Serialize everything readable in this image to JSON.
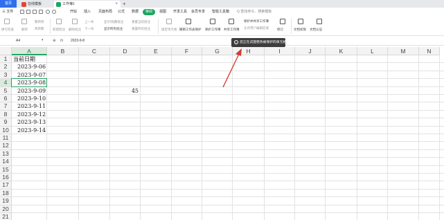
{
  "tabs": {
    "home": "首页",
    "items": [
      {
        "label": "在线模板",
        "icon_color": "#e0463b"
      },
      {
        "label": "工作簿1",
        "icon_color": "#1fa463"
      }
    ],
    "close": "×",
    "add": "+"
  },
  "menu": {
    "file": "三 文件",
    "items": [
      "开始",
      "插入",
      "页面布局",
      "公式",
      "数据",
      "审阅",
      "视图",
      "开发工具",
      "会员专享",
      "智能工具箱"
    ],
    "active": "审阅",
    "search_placeholder": "Q 查找命令、搜索模板"
  },
  "ribbon": {
    "row1": [
      "拼写检查",
      "翻译",
      "校对",
      "新建批注",
      "删除批注",
      "上一条",
      "下一条",
      "显示/隐藏批注",
      "显示所有批注",
      "重置当前批注",
      "重置所有批注",
      "锁定单元格",
      "保护工作表",
      "保护工作簿",
      "共享工作簿",
      "保护并共享工作簿",
      "允许用户编辑区域",
      "修订",
      "文档权限",
      "文档认证"
    ],
    "labels": {
      "spell": "拼写检查·",
      "research": "翻译",
      "proof": "校对",
      "word_count": "繁转简",
      "simp_trad": "简转繁",
      "new_comment": "新建批注",
      "del_comment": "删除批注",
      "prev": "上一条",
      "next": "下一条",
      "show_hide": "显示/隐藏批注",
      "show_all": "显示所有批注",
      "reset_cur": "重置当前批注",
      "reset_all": "重置所有批注",
      "lock_cell": "锁定单元格",
      "protect_sheet": "撤销工作表保护",
      "protect_wb": "保护工作簿",
      "share_wb": "共享工作簿",
      "protect_share": "保护并共享工作簿",
      "allow_edit": "允许用户编辑区域",
      "track": "修订·",
      "doc_perm": "文档权限",
      "doc_cert": "文档认证·"
    }
  },
  "formula_bar": {
    "name_box": "A4",
    "fx": "fx",
    "value": "2023-9-8"
  },
  "grid": {
    "columns": [
      "A",
      "B",
      "C",
      "D",
      "E",
      "F",
      "G",
      "H",
      "I",
      "J",
      "K",
      "L",
      "M",
      "N"
    ],
    "selected_column": "A",
    "selected_row": "4",
    "rows": [
      "1",
      "2",
      "3",
      "4",
      "5",
      "6",
      "7",
      "8",
      "9",
      "10",
      "11",
      "12",
      "13",
      "14",
      "15",
      "16",
      "17",
      "18",
      "19",
      "20",
      "21"
    ],
    "cells": {
      "A1": "当前日期",
      "A2": "2023-9-06",
      "A3": "2023-9-07",
      "A4": "2023-9-08",
      "A5": "2023-9-09",
      "A6": "2023-9-10",
      "A7": "2023-9-11",
      "A8": "2023-9-12",
      "A9": "2023-9-13",
      "A10": "2023-9-14",
      "D5": "45"
    }
  },
  "tooltip": {
    "text": "您正在试图更改被保护的单元格",
    "icon": "i"
  },
  "colors": {
    "accent": "#1fa463",
    "home_tab": "#2f6fed",
    "arrow": "#d63a34"
  }
}
